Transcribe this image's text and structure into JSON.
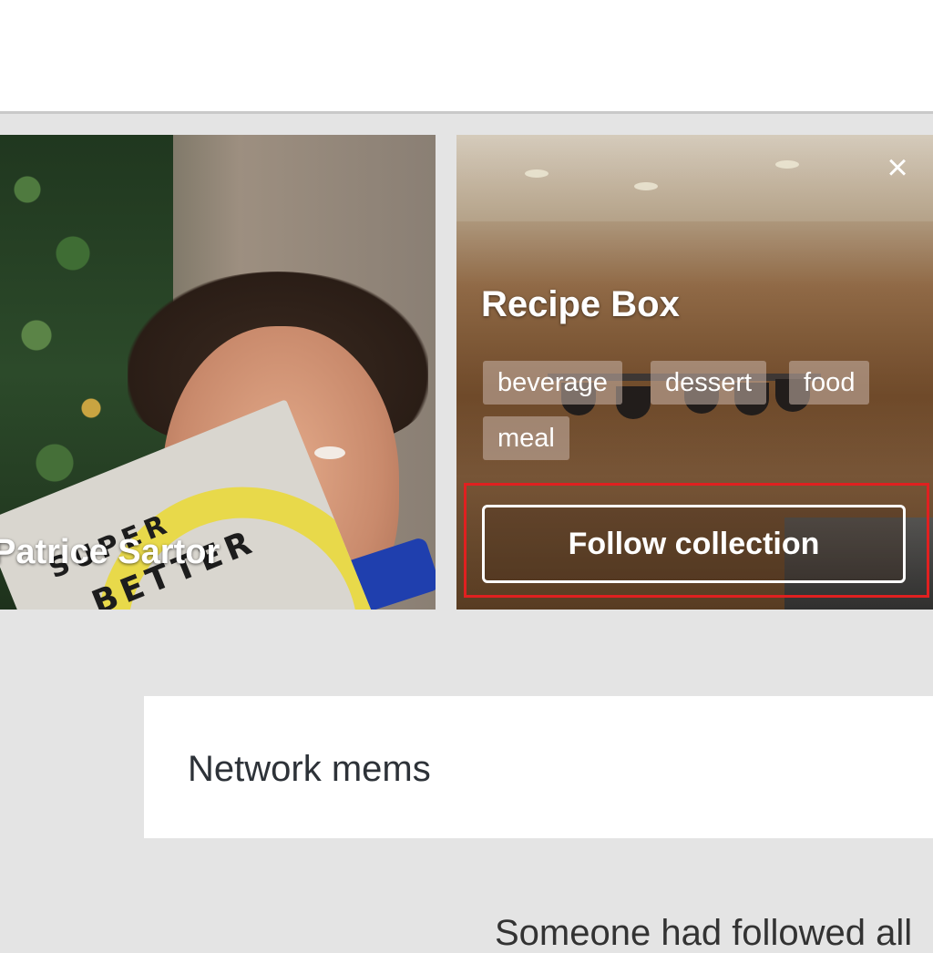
{
  "cards": [
    {
      "name": "Patrice Sartor",
      "image": "person-photo"
    },
    {
      "title": "Recipe Box",
      "tags": [
        "beverage",
        "dessert",
        "food",
        "meal"
      ],
      "follow_label": "Follow collection",
      "close_icon": "close-icon",
      "image": "kitchen-photo"
    }
  ],
  "network": {
    "title": "Network mems"
  },
  "footer": {
    "partial_text": "Someone had followed all"
  },
  "colors": {
    "background": "#e4e4e4",
    "panel": "#ffffff",
    "highlight": "#e02020",
    "card_text": "#ffffff"
  }
}
